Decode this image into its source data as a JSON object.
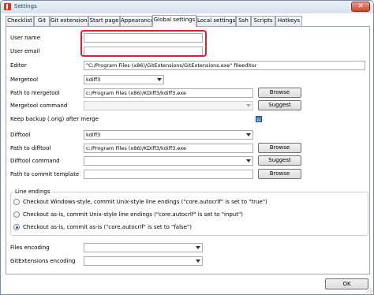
{
  "window": {
    "title": "Settings",
    "close_glyph": "✕"
  },
  "tabs": [
    {
      "label": "Checklist"
    },
    {
      "label": "Git"
    },
    {
      "label": "Git extensions"
    },
    {
      "label": "Start page"
    },
    {
      "label": "Appearance"
    },
    {
      "label": "Global settings"
    },
    {
      "label": "Local settings"
    },
    {
      "label": "Ssh"
    },
    {
      "label": "Scripts"
    },
    {
      "label": "Hotkeys"
    }
  ],
  "active_tab": "Global settings",
  "fields": {
    "user_name": {
      "label": "User name",
      "value": ""
    },
    "user_email": {
      "label": "User email",
      "value": ""
    },
    "editor": {
      "label": "Editor",
      "value": "\"C:/Program Files (x86)/GitExtensions/GitExtensions.exe\" fileeditor"
    },
    "mergetool": {
      "label": "Mergetool",
      "value": "kdiff3"
    },
    "path_to_mergetool": {
      "label": "Path to mergetool",
      "value": "c:/Program Files (x86)/KDiff3/kdiff3.exe"
    },
    "mergetool_command": {
      "label": "Mergetool command",
      "value": ""
    },
    "keep_backup": {
      "label": "Keep backup (.orig) after merge",
      "checked": true
    },
    "difftool": {
      "label": "Difftool",
      "value": "kdiff3"
    },
    "path_to_difftool": {
      "label": "Path to difftool",
      "value": "c:/Program Files (x86)/KDiff3/kdiff3.exe"
    },
    "difftool_command": {
      "label": "Difftool command",
      "value": ""
    },
    "path_to_commit_template": {
      "label": "Path to commit template",
      "value": ""
    },
    "files_encoding": {
      "label": "Files encoding",
      "value": ""
    },
    "gitextensions_encoding": {
      "label": "GitExtensions encoding",
      "value": ""
    }
  },
  "buttons": {
    "browse": "Browse",
    "suggest": "Suggest",
    "ok": "OK"
  },
  "line_endings": {
    "title": "Line endings",
    "options": [
      {
        "label": "Checkout Windows-style, commit Unix-style line endings (\"core.autocrlf\"  is set to \"true\")",
        "checked": false
      },
      {
        "label": "Checkout as-is, commit Unix-style line endings (\"core.autocrlf\"  is set to \"input\")",
        "checked": false
      },
      {
        "label": "Checkout as-is, commit as-is (\"core.autocrlf\"  is set to \"false\")",
        "checked": true
      }
    ]
  },
  "colors": {
    "highlight": "#e0202c",
    "title_text": "#1e3f66"
  }
}
